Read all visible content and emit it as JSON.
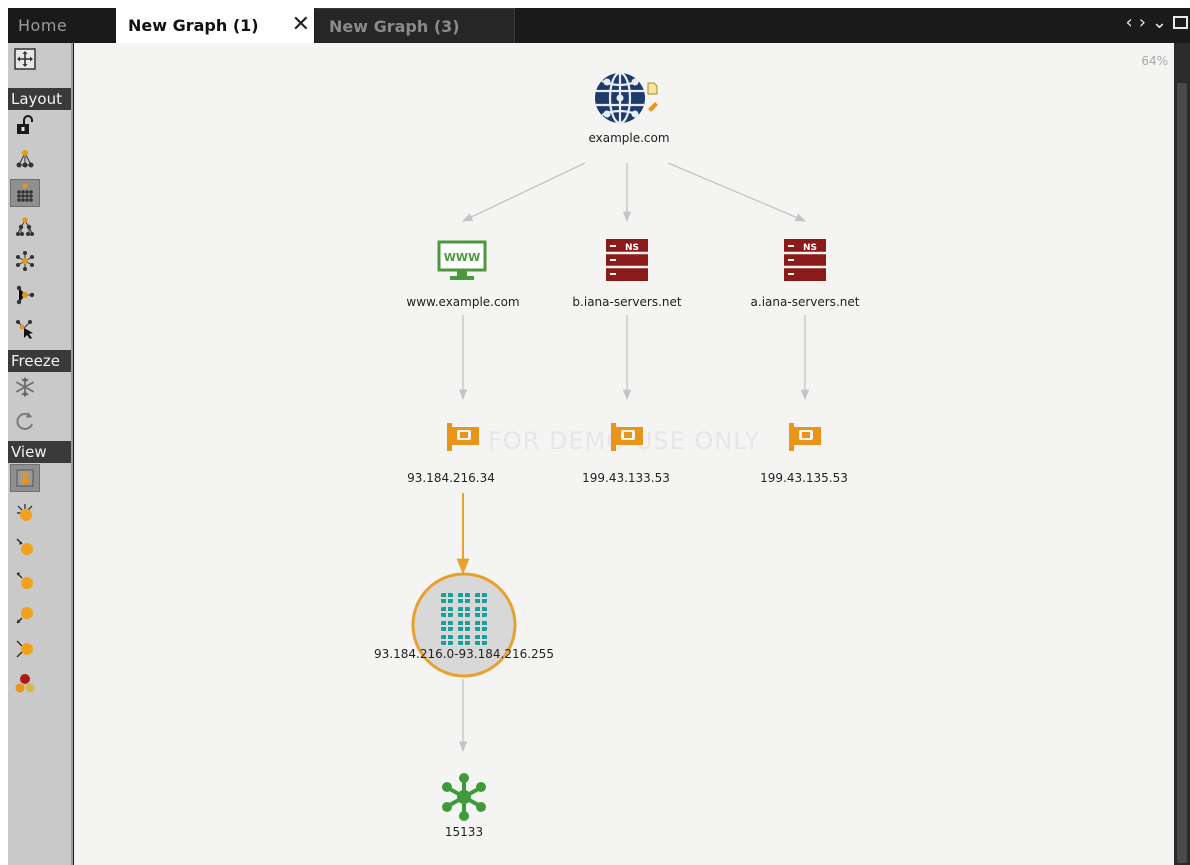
{
  "tabs": [
    {
      "label": "Home"
    },
    {
      "label": "New Graph (1)",
      "close": "✕"
    },
    {
      "label": "New Graph (3)"
    }
  ],
  "window_controls": {
    "prev": "‹",
    "next": "›",
    "menu": "⌄"
  },
  "toolbar": {
    "sections": {
      "layout": "Layout",
      "freeze": "Freeze",
      "view": "View"
    },
    "icons": [
      "move-icon",
      "lock-icon",
      "organic-layout-icon",
      "block-layout-icon",
      "hierarchical-layout-icon",
      "circular-layout-icon",
      "interactive-layout-icon",
      "pointer-layout-icon",
      "freeze-icon",
      "refresh-icon",
      "main-view-icon",
      "ranked-by-links-icon",
      "incoming-links-icon",
      "outgoing-links-icon",
      "bidirectional-links-icon",
      "weighted-icon",
      "entity-ranked-icon"
    ]
  },
  "canvas": {
    "zoom": "64%",
    "watermark": "FOR DEMO USE ONLY",
    "nodes": [
      {
        "id": "domain",
        "label": "example.com",
        "icon": "globe-icon"
      },
      {
        "id": "website",
        "label": "www.example.com",
        "icon": "website-icon",
        "badge": "WWW"
      },
      {
        "id": "ns-b",
        "label": "b.iana-servers.net",
        "icon": "nameserver-icon",
        "badge": "NS"
      },
      {
        "id": "ns-a",
        "label": "a.iana-servers.net",
        "icon": "nameserver-icon",
        "badge": "NS"
      },
      {
        "id": "ip1",
        "label": "93.184.216.34",
        "icon": "ip-address-icon"
      },
      {
        "id": "ip2",
        "label": "199.43.133.53",
        "icon": "ip-address-icon"
      },
      {
        "id": "ip3",
        "label": "199.43.135.53",
        "icon": "ip-address-icon"
      },
      {
        "id": "netblock",
        "label": "93.184.216.0-93.184.216.255",
        "icon": "netblock-icon"
      },
      {
        "id": "as",
        "label": "15133",
        "icon": "as-number-icon"
      }
    ],
    "edges": [
      {
        "from": "domain",
        "to": "website"
      },
      {
        "from": "domain",
        "to": "ns-b"
      },
      {
        "from": "domain",
        "to": "ns-a"
      },
      {
        "from": "website",
        "to": "ip1"
      },
      {
        "from": "ns-b",
        "to": "ip2"
      },
      {
        "from": "ns-a",
        "to": "ip3"
      },
      {
        "from": "ip1",
        "to": "netblock",
        "highlighted": true
      },
      {
        "from": "netblock",
        "to": "as"
      }
    ],
    "colors": {
      "edge": "#c4c4c4",
      "highlight": "#e8a12e",
      "website": "#4a9a3c",
      "nameserver": "#8b1a1a",
      "ip": "#e8951a",
      "netblock": "#1a9e9a",
      "as": "#3e9a3a",
      "globe": "#1e3a6b"
    }
  }
}
